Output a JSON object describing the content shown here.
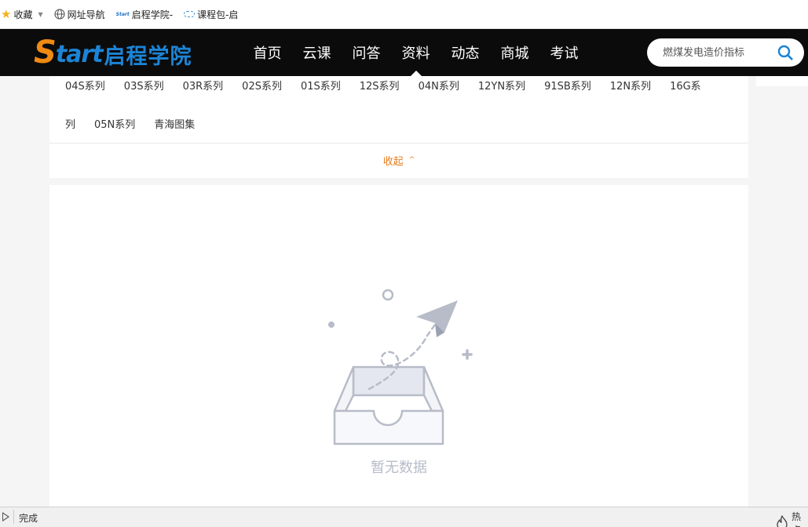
{
  "favorites_bar": {
    "items": [
      {
        "label": "收藏",
        "icon": "star-icon"
      },
      {
        "label": "网址导航",
        "icon": "globe-icon"
      },
      {
        "label": "启程学院-",
        "icon": "start-logo-icon",
        "icon_text": "Start"
      },
      {
        "label": "课程包-启",
        "icon": "cloud-icon"
      }
    ]
  },
  "header": {
    "logo": {
      "s": "S",
      "tart": "tart",
      "cn": "启程学院"
    },
    "nav": [
      "首页",
      "云课",
      "问答",
      "资料",
      "动态",
      "商城",
      "考试"
    ],
    "active_nav": "资料",
    "search": {
      "placeholder": "燃煤发电造价指标",
      "icon": "search-icon"
    },
    "colors": {
      "background": "#0b0b0b",
      "logo_orange": "#f08a13",
      "logo_blue": "#1c84d6",
      "search_icon": "#1c84d6"
    }
  },
  "tags": {
    "row1": [
      "04S系列",
      "03S系列",
      "03R系列",
      "02S系列",
      "01S系列",
      "12S系列",
      "04N系列",
      "12YN系列",
      "91SB系列",
      "12N系列",
      "16G系"
    ],
    "row2": [
      "列",
      "05N系列",
      "青海图集"
    ],
    "collapse_label": "收起",
    "collapse_color": "#e67e22"
  },
  "content": {
    "empty_text": "暂无数据",
    "empty_icon": "empty-inbox-paper-plane-icon"
  },
  "status_bar": {
    "text": "完成",
    "right_label": "热点"
  }
}
